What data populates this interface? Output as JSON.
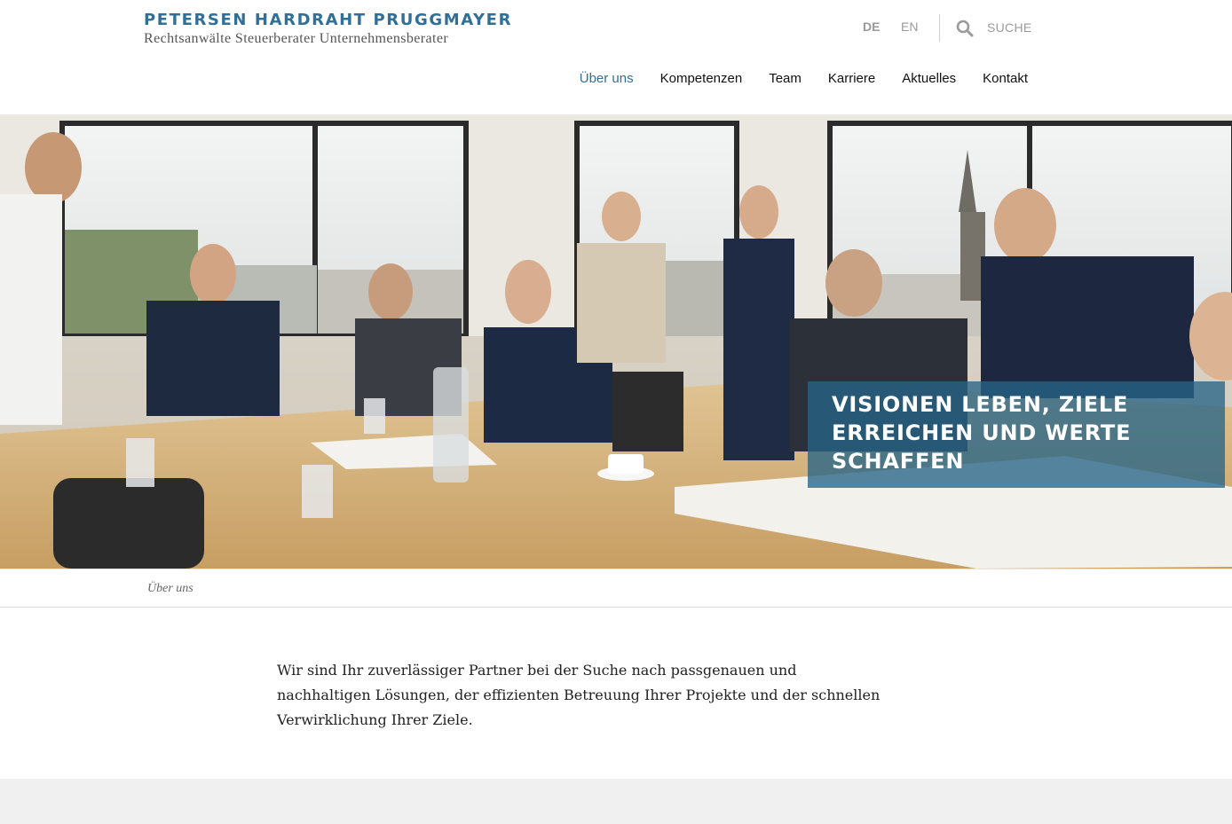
{
  "brand": {
    "title": "PETERSEN HARDRAHT PRUGGMAYER",
    "subtitle": "Rechtsanwälte Steuerberater Unternehmensberater"
  },
  "language": {
    "de": "DE",
    "en": "EN"
  },
  "search": {
    "label": "SUCHE",
    "icon": "search-icon"
  },
  "nav": {
    "items": [
      {
        "label": "Über uns"
      },
      {
        "label": "Kompetenzen"
      },
      {
        "label": "Team"
      },
      {
        "label": "Karriere"
      },
      {
        "label": "Aktuelles"
      },
      {
        "label": "Kontakt"
      }
    ]
  },
  "hero": {
    "caption": "VISIONEN LEBEN, ZIELE ERREICHEN UND WERTE SCHAFFEN"
  },
  "breadcrumb": {
    "current": "Über uns"
  },
  "intro": {
    "text": "Wir sind Ihr zuverlässiger Partner bei der Suche nach passgenauen und nachhaltigen Lösungen, der effizienten Betreuung Ihrer Projekte und der schnellen Verwirklichung Ihrer Ziele."
  },
  "colors": {
    "brand_blue": "#2f6f98",
    "caption_bg": "#266487",
    "muted_text": "#9a9a9a"
  }
}
